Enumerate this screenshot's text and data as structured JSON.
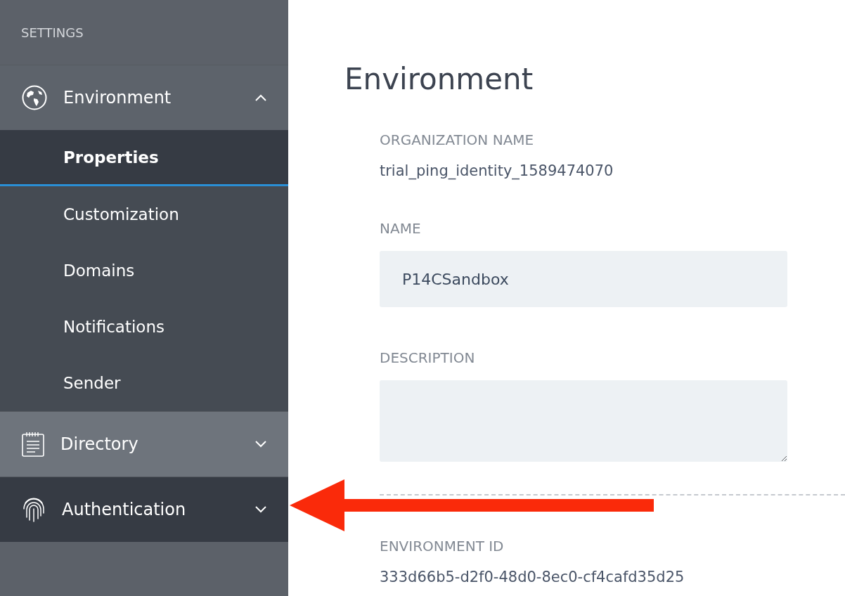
{
  "sidebar": {
    "heading": "SETTINGS",
    "sections": [
      {
        "label": "Environment",
        "expanded": true,
        "selected": false,
        "items": [
          {
            "label": "Properties",
            "selected": true
          },
          {
            "label": "Customization",
            "selected": false
          },
          {
            "label": "Domains",
            "selected": false
          },
          {
            "label": "Notifications",
            "selected": false
          },
          {
            "label": "Sender",
            "selected": false
          }
        ]
      },
      {
        "label": "Directory",
        "expanded": false,
        "selected": false
      },
      {
        "label": "Authentication",
        "expanded": false,
        "selected": true
      }
    ]
  },
  "main": {
    "title": "Environment",
    "fields": [
      {
        "kind": "text",
        "label": "ORGANIZATION NAME",
        "value": "trial_ping_identity_1589474070"
      },
      {
        "kind": "input",
        "label": "NAME",
        "value": "P14CSandbox"
      },
      {
        "kind": "textarea",
        "label": "DESCRIPTION"
      },
      {
        "kind": "divider"
      },
      {
        "kind": "text",
        "label": "ENVIRONMENT ID",
        "value": "333d66b5-d2f0-48d0-8ec0-cf4cafd35d25"
      }
    ]
  }
}
